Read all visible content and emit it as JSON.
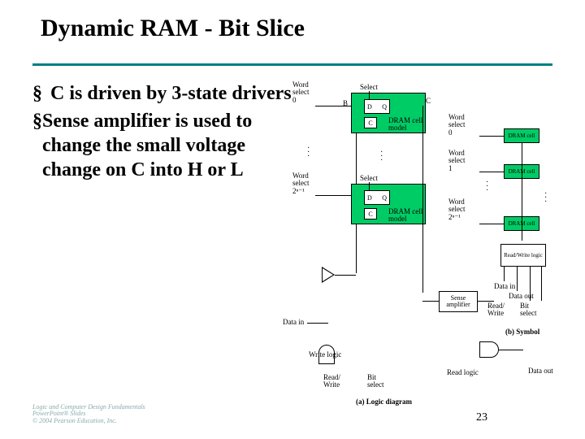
{
  "title": "Dynamic RAM - Bit Slice",
  "bullets": [
    "C is driven by 3-state drivers",
    "Sense amplifier is used to change the small voltage change on C into H or L"
  ],
  "bullet_mark": "§",
  "labels": {
    "word_select_0": "Word\nselect\n0",
    "word_select_1": "Word\nselect\n1",
    "word_select_last": "Word\nselect\n2ⁿ⁻¹",
    "select": "Select",
    "B": "B",
    "C": "C",
    "D": "D",
    "Q": "Q",
    "dram_cell_model": "DRAM cell\nmodel",
    "dram_cell": "DRAM cell",
    "sense_amplifier": "Sense\namplifier",
    "data_in": "Data in",
    "data_out": "Data out",
    "read_write": "Read/\nWrite",
    "bit_select": "Bit\nselect",
    "write_logic": "Write logic",
    "read_logic": "Read logic",
    "read_write_logic": "Read/Write\nlogic",
    "a_logic_diagram": "(a) Logic diagram",
    "b_symbol": "(b) Symbol"
  },
  "footer": {
    "l1": "Logic and Computer Design Fundamentals",
    "l2": "PowerPoint® Slides",
    "l3": "© 2004 Pearson Education, Inc."
  },
  "pagenum": "23"
}
